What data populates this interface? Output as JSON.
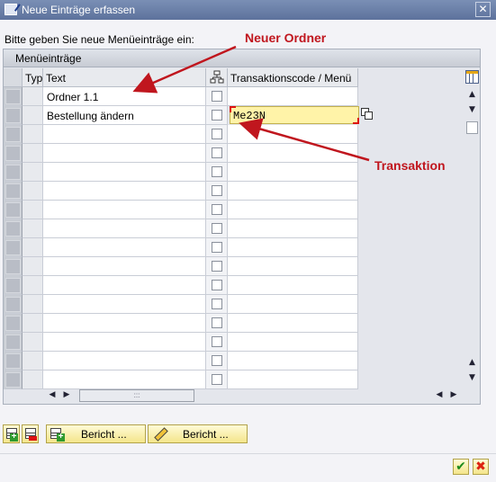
{
  "window": {
    "title": "Neue Einträge erfassen",
    "close_glyph": "✕"
  },
  "prompt": "Bitte geben Sie neue Menüeinträge ein:",
  "table": {
    "title": "Menüeinträge",
    "columns": [
      "Typ",
      "Text",
      "Transaktionscode / Menü"
    ],
    "rows": [
      {
        "text": "Ordner 1.1",
        "code": ""
      },
      {
        "text": "Bestellung ändern",
        "code": "Me23N"
      },
      {
        "text": "",
        "code": ""
      },
      {
        "text": "",
        "code": ""
      },
      {
        "text": "",
        "code": ""
      },
      {
        "text": "",
        "code": ""
      },
      {
        "text": "",
        "code": ""
      },
      {
        "text": "",
        "code": ""
      },
      {
        "text": "",
        "code": ""
      },
      {
        "text": "",
        "code": ""
      },
      {
        "text": "",
        "code": ""
      },
      {
        "text": "",
        "code": ""
      },
      {
        "text": "",
        "code": ""
      },
      {
        "text": "",
        "code": ""
      },
      {
        "text": "",
        "code": ""
      },
      {
        "text": "",
        "code": ""
      }
    ]
  },
  "scroll": {
    "up": "▲",
    "down": "▼",
    "left": "◀",
    "right": "▶",
    "grip": ":::"
  },
  "buttons": {
    "bericht_1": "Bericht ...",
    "bericht_2": "Bericht ...",
    "ok": "✔",
    "cancel": "✖"
  },
  "annotations": {
    "neuer_ordner": "Neuer Ordner",
    "transaktion": "Transaktion",
    "color": "#c0161e"
  }
}
